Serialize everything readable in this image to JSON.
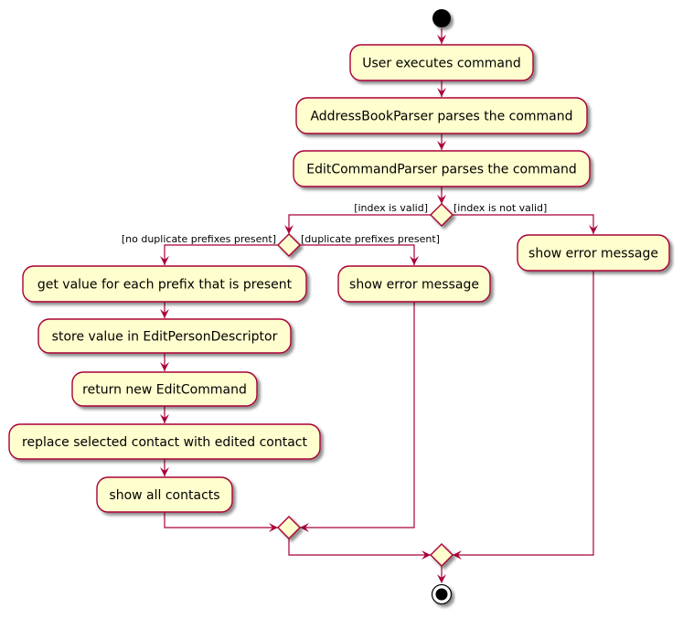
{
  "diagram": {
    "type": "activity",
    "colors": {
      "line": "#A80036",
      "fill": "#FEFECE",
      "text": "#000000",
      "start": "#000000",
      "shadow": "#9a9a9a"
    },
    "activities": {
      "user_executes": "User executes command",
      "addressbook_parses": "AddressBookParser parses the command",
      "editcommand_parses": "EditCommandParser parses the command",
      "show_error_index": "show error message",
      "get_value": "get value for each prefix that is present",
      "show_error_duplicate": "show error message",
      "store_value": "store value in EditPersonDescriptor",
      "return_command": "return new EditCommand",
      "replace_contact": "replace selected contact with edited contact",
      "show_all": "show all contacts"
    },
    "guards": {
      "index_valid": "[index is valid]",
      "index_not_valid": "[index is not valid]",
      "no_duplicate": "[no duplicate prefixes present]",
      "duplicate": "[duplicate prefixes present]"
    }
  }
}
